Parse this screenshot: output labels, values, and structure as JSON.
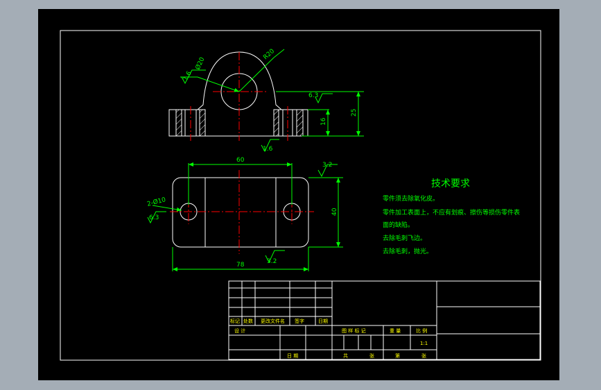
{
  "colors": {
    "viewport_bg": "#a4adb6",
    "sheet_bg": "#000000",
    "frame": "#ffffff",
    "outline": "#ffffff",
    "dimension": "#00ff00",
    "center_line": "#ff0000",
    "hatch": "#ff0000",
    "tech_text": "#00ff00",
    "title_text": "#ffff00"
  },
  "top_view": {
    "dim_r20": "R20",
    "dim_d20": "Ø20",
    "rough_ra_left": "1.6",
    "rough_ra_right": "6.3",
    "rough_ra_bottom": "1.6",
    "dim_height_16": "16",
    "dim_height_25": "25"
  },
  "bottom_view": {
    "dim_width_60": "60",
    "dim_width_78": "78",
    "dim_height_40": "40",
    "dim_holes": "2-Ø10",
    "rough_holes": "6.3",
    "rough_top_right": "3.2",
    "rough_bottom": "3.2"
  },
  "tech_requirements": {
    "title": "技术要求",
    "lines": [
      "零件须去除氧化皮。",
      "零件加工表面上，不应有划痕、擦伤等损伤零件表",
      "面的缺陷。",
      "去除毛刺飞边。",
      "去除毛刺，抛光。"
    ]
  },
  "title_block": {
    "labels_row": [
      "标记",
      "处数",
      "更改文件名",
      "签字",
      "日期"
    ],
    "design": "设 计",
    "date": "日 期",
    "stage_labels": [
      "图 样 标 记",
      "重 量",
      "比 例"
    ],
    "scale": "1:1",
    "total_sheets": "共",
    "sheet_unit": "张",
    "sheet_no": "第",
    "sheet_unit2": "张"
  }
}
